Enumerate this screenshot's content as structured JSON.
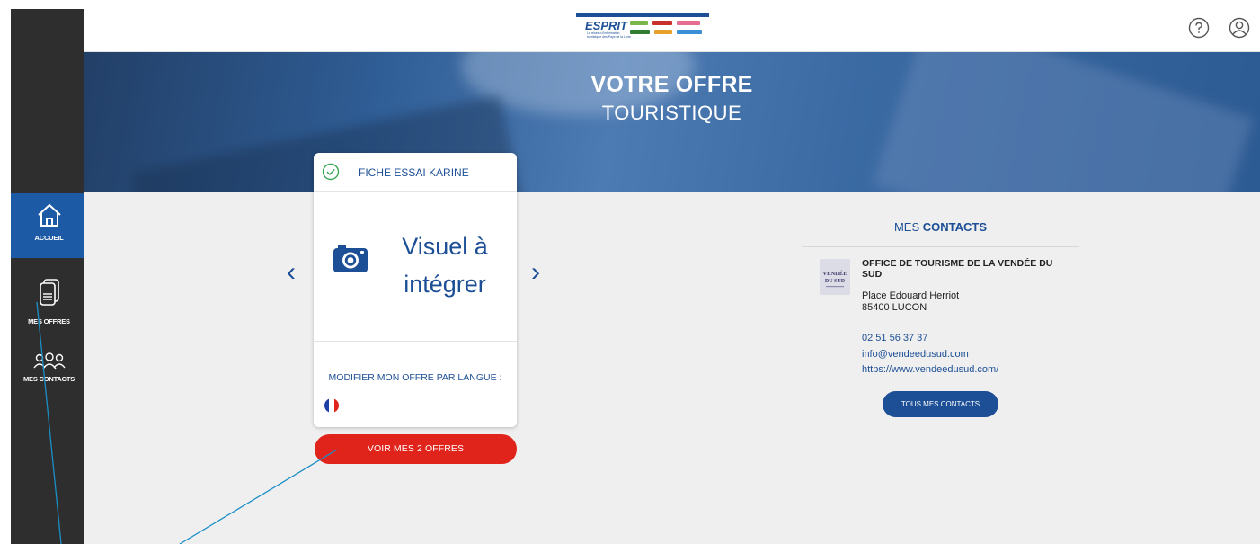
{
  "app": {
    "logo_text": "ESPRIT",
    "logo_sub": "Le réseau d'information touristique des Pays de la Loire"
  },
  "sidebar": {
    "items": [
      {
        "label": "ACCUEIL"
      },
      {
        "label": "MES OFFRES"
      },
      {
        "label": "MES CONTACTS"
      }
    ]
  },
  "header": {
    "help_icon": "help-icon",
    "account_icon": "user-icon"
  },
  "hero": {
    "title_bold": "VOTRE OFFRE",
    "title_light": "TOURISTIQUE"
  },
  "card": {
    "title": "FICHE ESSAI KARINE",
    "visual_line1": "Visuel à",
    "visual_line2": "intégrer",
    "lang_label": "MODIFIER MON OFFRE PAR LANGUE :",
    "flag_icon": "france-flag-icon"
  },
  "carousel": {
    "prev_label": "‹",
    "next_label": "›"
  },
  "offers_button": "VOIR MES 2 OFFRES",
  "contacts": {
    "title_light": "MES",
    "title_bold": "CONTACTS",
    "name": "OFFICE DE TOURISME DE LA VENDÉE DU SUD",
    "address_line1": "Place Edouard Herriot",
    "address_line2": "85400 LUCON",
    "phone": "02 51 56 37 37",
    "email": "info@vendeedusud.com",
    "website": "https://www.vendeedusud.com/",
    "logo_text": "VENDÉE DU SUD",
    "button": "TOUS MES CONTACTS"
  },
  "colors": {
    "brand_blue": "#1d4f96",
    "accent_red": "#e0241b",
    "sidebar": "#2e2e2e",
    "active": "#1d5aa6"
  }
}
